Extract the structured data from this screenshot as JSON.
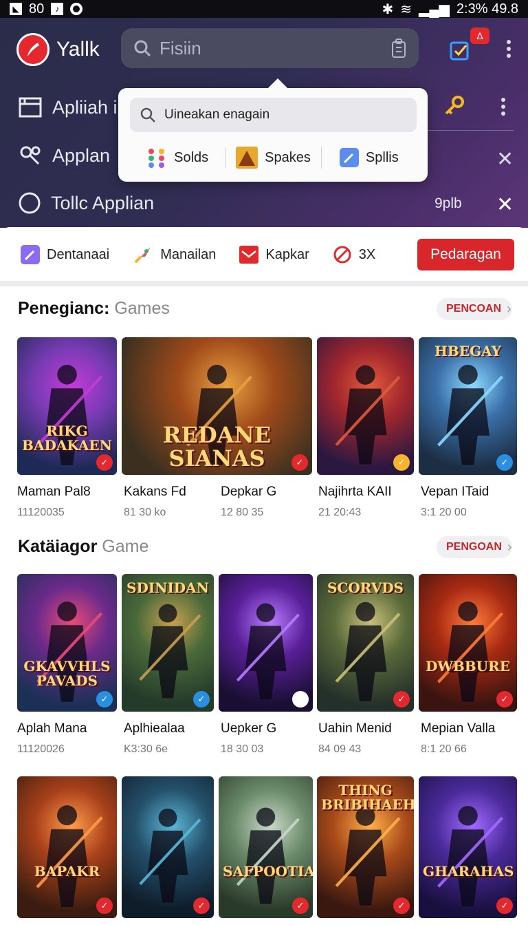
{
  "status": {
    "left_num": "80",
    "right_text": "2:3% 49.8"
  },
  "header": {
    "app_name": "Yallk",
    "search_placeholder": "Fisiin",
    "badge": "Δ",
    "rows": [
      {
        "label": "Apliiah i"
      },
      {
        "label": "Applan"
      },
      {
        "label": "Tollc Applian",
        "trailing": "9plb"
      }
    ]
  },
  "popup": {
    "search_text": "Uineakan enagain",
    "items": [
      {
        "label": "Solds"
      },
      {
        "label": "Spakes"
      },
      {
        "label": "Spllis"
      }
    ]
  },
  "quickbar": {
    "items": [
      {
        "label": "Dentanaai"
      },
      {
        "label": "Manailan"
      },
      {
        "label": "Kapkar"
      },
      {
        "label": "3X"
      }
    ],
    "button": "Pedaragan"
  },
  "sections": [
    {
      "title": "Penegianc:",
      "subtitle": "Games",
      "more": "PENCOAN",
      "games": [
        {
          "name": "Maman Pal8",
          "meta": "11120035",
          "art": "RIKG BADAKAEN"
        },
        {
          "name": "Kakans Fd",
          "meta": "81 30 ko",
          "art": "REDANE SIANAS"
        },
        {
          "name": "Depkar G",
          "meta": "12 80 35",
          "art": ""
        },
        {
          "name": "Najihrta KAII",
          "meta": "21 20:43",
          "art": ""
        },
        {
          "name": "Vepan ITaid",
          "meta": "3:1 20 00",
          "art": "HBEGAY"
        }
      ]
    },
    {
      "title": "Katäiagor",
      "subtitle": "Game",
      "more": "PENGOAN",
      "games": [
        {
          "name": "Aplah Mana",
          "meta": "11120026",
          "art": "GKAVVHLS PAVADS"
        },
        {
          "name": "Aplhiealaa",
          "meta": "K3:30 6e",
          "art": "SDINIDAN"
        },
        {
          "name": "Uepker G",
          "meta": "18 30 03",
          "art": ""
        },
        {
          "name": "Uahin Menid",
          "meta": "84 09 43",
          "art": "SCORVDS"
        },
        {
          "name": "Mepian Valla",
          "meta": "8:1 20 66",
          "art": "DWBBURE"
        }
      ]
    },
    {
      "games": [
        {
          "art": "BAPAKR"
        },
        {
          "art": ""
        },
        {
          "art": "SAFPOOTIAS"
        },
        {
          "art": "THING BRIBIHAEH"
        },
        {
          "art": "GHARAHAS"
        }
      ]
    }
  ],
  "colors": {
    "accent": "#d9262b",
    "header_start": "#2b2c4a",
    "header_end": "#5c3678"
  }
}
